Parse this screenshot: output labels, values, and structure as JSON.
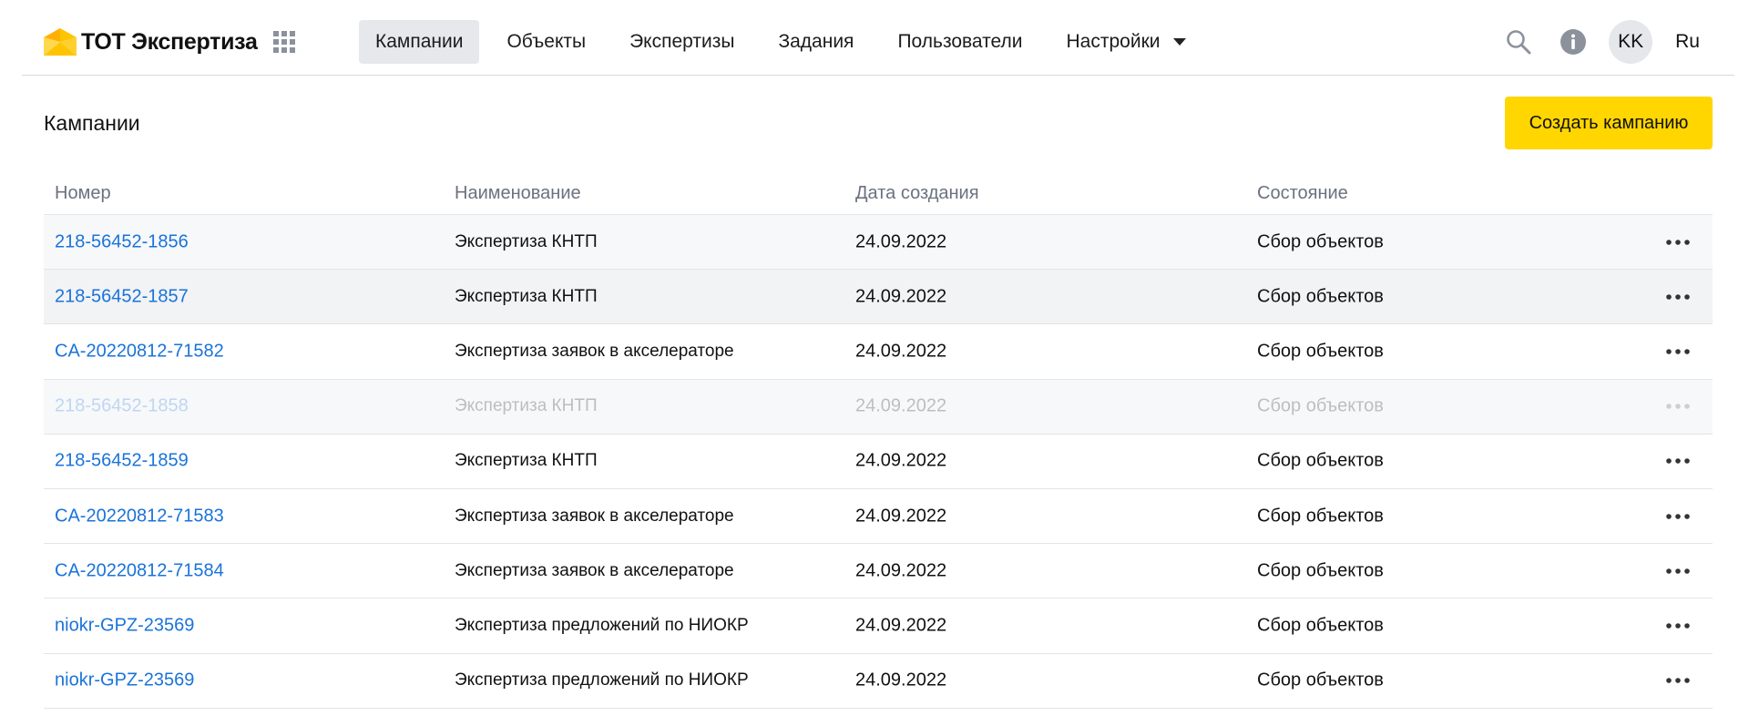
{
  "app": {
    "brand": "ТОТ Экспертиза"
  },
  "nav": {
    "items": [
      {
        "label": "Кампании",
        "active": true
      },
      {
        "label": "Объекты",
        "active": false
      },
      {
        "label": "Экспертизы",
        "active": false
      },
      {
        "label": "Задания",
        "active": false
      },
      {
        "label": "Пользователи",
        "active": false
      },
      {
        "label": "Настройки",
        "active": false,
        "has_dropdown": true
      }
    ]
  },
  "header_right": {
    "avatar_initials": "KK",
    "language": "Ru",
    "icons": [
      "search-icon",
      "info-icon"
    ]
  },
  "page": {
    "title": "Кампании",
    "create_button": "Создать кампанию"
  },
  "table": {
    "columns": [
      "Номер",
      "Наименование",
      "Дата создания",
      "Состояние"
    ],
    "rows": [
      {
        "number": "218-56452-1856",
        "name": "Экспертиза КНТП",
        "date": "24.09.2022",
        "status": "Сбор объектов"
      },
      {
        "number": "218-56452-1857",
        "name": "Экспертиза КНТП",
        "date": "24.09.2022",
        "status": "Сбор объектов"
      },
      {
        "number": "CA-20220812-71582",
        "name": "Экспертиза заявок в акселераторе",
        "date": "24.09.2022",
        "status": "Сбор объектов"
      },
      {
        "number": "218-56452-1858",
        "name": "Экспертиза КНТП",
        "date": "24.09.2022",
        "status": "Сбор объектов"
      },
      {
        "number": "218-56452-1859",
        "name": "Экспертиза КНТП",
        "date": "24.09.2022",
        "status": "Сбор объектов"
      },
      {
        "number": "CA-20220812-71583",
        "name": "Экспертиза заявок в акселераторе",
        "date": "24.09.2022",
        "status": "Сбор объектов"
      },
      {
        "number": "CA-20220812-71584",
        "name": "Экспертиза заявок в акселераторе",
        "date": "24.09.2022",
        "status": "Сбор объектов"
      },
      {
        "number": "niokr-GPZ-23569",
        "name": "Экспертиза предложений по НИОКР",
        "date": "24.09.2022",
        "status": "Сбор объектов"
      },
      {
        "number": "niokr-GPZ-23569",
        "name": "Экспертиза предложений по НИОКР",
        "date": "24.09.2022",
        "status": "Сбор объектов"
      }
    ]
  },
  "colors": {
    "accent": "#ffd600",
    "link": "#1a73d9",
    "muted_text": "#6a7280",
    "nav_active_bg": "#e6e8ec",
    "logo_yellow": "#ffc400"
  }
}
